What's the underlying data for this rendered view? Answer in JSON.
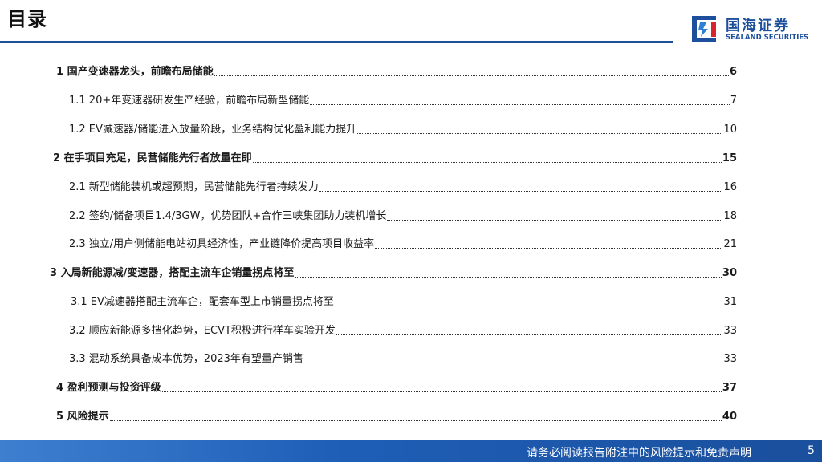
{
  "header": {
    "title": "目录",
    "logo": {
      "name_cn": "国海证券",
      "name_en": "SEALAND SECURITIES",
      "icon": "sealand-logo-icon"
    }
  },
  "toc": [
    {
      "text": "1 国产变速器龙头，前瞻布局储能",
      "page": "6",
      "level": 1
    },
    {
      "text": "1.1 20+年变速器研发生产经验，前瞻布局新型储能",
      "page": "7",
      "level": 2
    },
    {
      "text": "1.2 EV减速器/储能进入放量阶段，业务结构优化盈利能力提升",
      "page": "10",
      "level": 2
    },
    {
      "text": "2 在手项目充足，民营储能先行者放量在即",
      "page": "15",
      "level": 1
    },
    {
      "text": "2.1 新型储能装机或超预期，民营储能先行者持续发力",
      "page": "16",
      "level": 2
    },
    {
      "text": "2.2 签约/储备项目1.4/3GW，优势团队+合作三峡集团助力装机增长",
      "page": "18",
      "level": 2
    },
    {
      "text": "2.3 独立/用户侧储能电站初具经济性，产业链降价提高项目收益率",
      "page": "21",
      "level": 2
    },
    {
      "text": "3 入局新能源减/变速器，搭配主流车企销量拐点将至",
      "page": "30",
      "level": 1
    },
    {
      "text": "3.1 EV减速器搭配主流车企，配套车型上市销量拐点将至",
      "page": "31",
      "level": 2
    },
    {
      "text": "3.2 顺应新能源多挡化趋势，ECVT积极进行样车实验开发",
      "page": "33",
      "level": 2
    },
    {
      "text": "3.3 混动系统具备成本优势，2023年有望量产销售",
      "page": "33",
      "level": 2
    },
    {
      "text": "4 盈利预测与投资评级",
      "page": "37",
      "level": 1
    },
    {
      "text": "5 风险提示",
      "page": "40",
      "level": 1
    }
  ],
  "footer": {
    "disclaimer": "请务必阅读报告附注中的风险提示和免责声明",
    "page_number": "5"
  },
  "colors": {
    "brand_blue": "#1d4f9c",
    "footer_blue": "#1f5fb8"
  }
}
